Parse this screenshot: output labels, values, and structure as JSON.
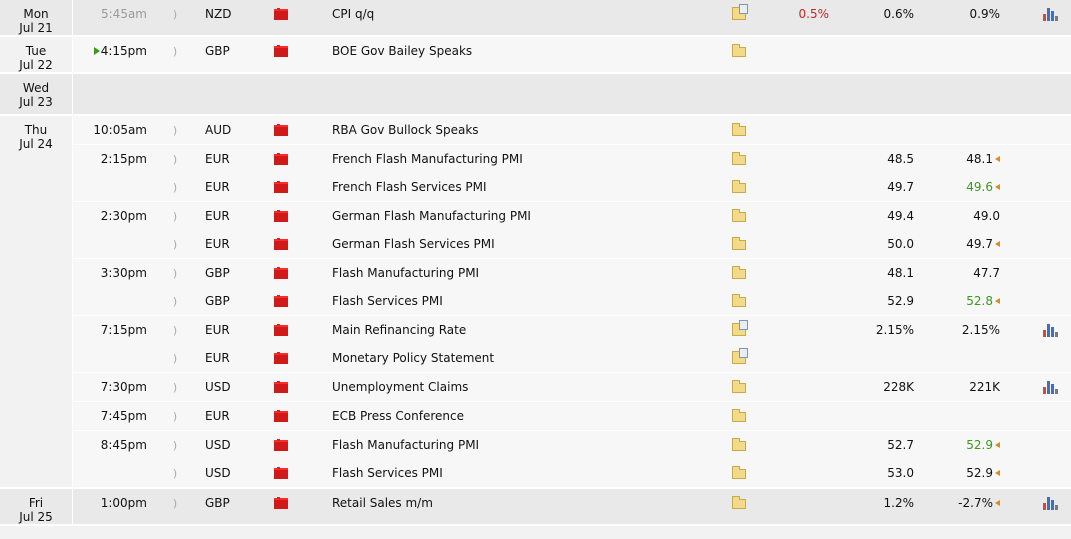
{
  "days": [
    {
      "weekday": "Mon",
      "date": "Jul 21",
      "shaded": true,
      "rows": [
        {
          "time": "5:45am",
          "time_dim": true,
          "currency": "NZD",
          "event": "CPI q/q",
          "detail": "folder-doc-icon",
          "actual": "0.5%",
          "actual_color": "red",
          "forecast": "0.6%",
          "previous": "0.9%",
          "chart": true
        }
      ]
    },
    {
      "weekday": "Tue",
      "date": "Jul 22",
      "shaded": false,
      "rows": [
        {
          "time": "4:15pm",
          "time_marker": true,
          "currency": "GBP",
          "event": "BOE Gov Bailey Speaks",
          "detail": "folder-icon",
          "actual": "",
          "forecast": "",
          "previous": "",
          "chart": false
        }
      ]
    },
    {
      "weekday": "Wed",
      "date": "Jul 23",
      "shaded": true,
      "rows": []
    },
    {
      "weekday": "Thu",
      "date": "Jul 24",
      "shaded": false,
      "rows": [
        {
          "time": "10:05am",
          "currency": "AUD",
          "event": "RBA Gov Bullock Speaks",
          "detail": "folder-icon",
          "actual": "",
          "forecast": "",
          "previous": "",
          "chart": false
        },
        {
          "time": "2:15pm",
          "sep": true,
          "currency": "EUR",
          "event": "French Flash Manufacturing PMI",
          "detail": "folder-icon",
          "actual": "",
          "forecast": "48.5",
          "previous": "48.1",
          "prev_revised": true,
          "chart": false
        },
        {
          "time": "",
          "currency": "EUR",
          "event": "French Flash Services PMI",
          "detail": "folder-icon",
          "actual": "",
          "forecast": "49.7",
          "previous": "49.6",
          "previous_color": "green",
          "prev_revised": true,
          "chart": false
        },
        {
          "time": "2:30pm",
          "sep": true,
          "currency": "EUR",
          "event": "German Flash Manufacturing PMI",
          "detail": "folder-icon",
          "actual": "",
          "forecast": "49.4",
          "previous": "49.0",
          "chart": false
        },
        {
          "time": "",
          "currency": "EUR",
          "event": "German Flash Services PMI",
          "detail": "folder-icon",
          "actual": "",
          "forecast": "50.0",
          "previous": "49.7",
          "prev_revised": true,
          "chart": false
        },
        {
          "time": "3:30pm",
          "sep": true,
          "currency": "GBP",
          "event": "Flash Manufacturing PMI",
          "detail": "folder-icon",
          "actual": "",
          "forecast": "48.1",
          "previous": "47.7",
          "chart": false
        },
        {
          "time": "",
          "currency": "GBP",
          "event": "Flash Services PMI",
          "detail": "folder-icon",
          "actual": "",
          "forecast": "52.9",
          "previous": "52.8",
          "previous_color": "green",
          "prev_revised": true,
          "chart": false
        },
        {
          "time": "7:15pm",
          "sep": true,
          "currency": "EUR",
          "event": "Main Refinancing Rate",
          "detail": "folder-doc-icon",
          "actual": "",
          "forecast": "2.15%",
          "previous": "2.15%",
          "chart": true
        },
        {
          "time": "",
          "currency": "EUR",
          "event": "Monetary Policy Statement",
          "detail": "folder-doc-icon",
          "actual": "",
          "forecast": "",
          "previous": "",
          "chart": false
        },
        {
          "time": "7:30pm",
          "sep": true,
          "currency": "USD",
          "event": "Unemployment Claims",
          "detail": "folder-icon",
          "actual": "",
          "forecast": "228K",
          "previous": "221K",
          "chart": true
        },
        {
          "time": "7:45pm",
          "sep": true,
          "currency": "EUR",
          "event": "ECB Press Conference",
          "detail": "folder-icon",
          "actual": "",
          "forecast": "",
          "previous": "",
          "chart": false
        },
        {
          "time": "8:45pm",
          "sep": true,
          "currency": "USD",
          "event": "Flash Manufacturing PMI",
          "detail": "folder-icon",
          "actual": "",
          "forecast": "52.7",
          "previous": "52.9",
          "previous_color": "green",
          "prev_revised": true,
          "chart": false
        },
        {
          "time": "",
          "currency": "USD",
          "event": "Flash Services PMI",
          "detail": "folder-icon",
          "actual": "",
          "forecast": "53.0",
          "previous": "52.9",
          "prev_revised": true,
          "chart": false
        }
      ]
    },
    {
      "weekday": "Fri",
      "date": "Jul 25",
      "shaded": true,
      "rows": [
        {
          "time": "1:00pm",
          "currency": "GBP",
          "event": "Retail Sales m/m",
          "detail": "folder-icon",
          "actual": "",
          "forecast": "1.2%",
          "previous": "-2.7%",
          "prev_revised": true,
          "chart": true
        }
      ]
    }
  ],
  "icons": {
    "impact": "impact-flag-icon",
    "sound": "sound-icon",
    "chart": "bar-chart-icon",
    "revised": "revision-arrow-icon",
    "next_event": "next-event-marker-icon"
  },
  "colors": {
    "impact_high": "#d01919",
    "actual_worse": "#c22828",
    "previous_better": "#3a9a1c",
    "revision_arrow": "#e08a17"
  }
}
